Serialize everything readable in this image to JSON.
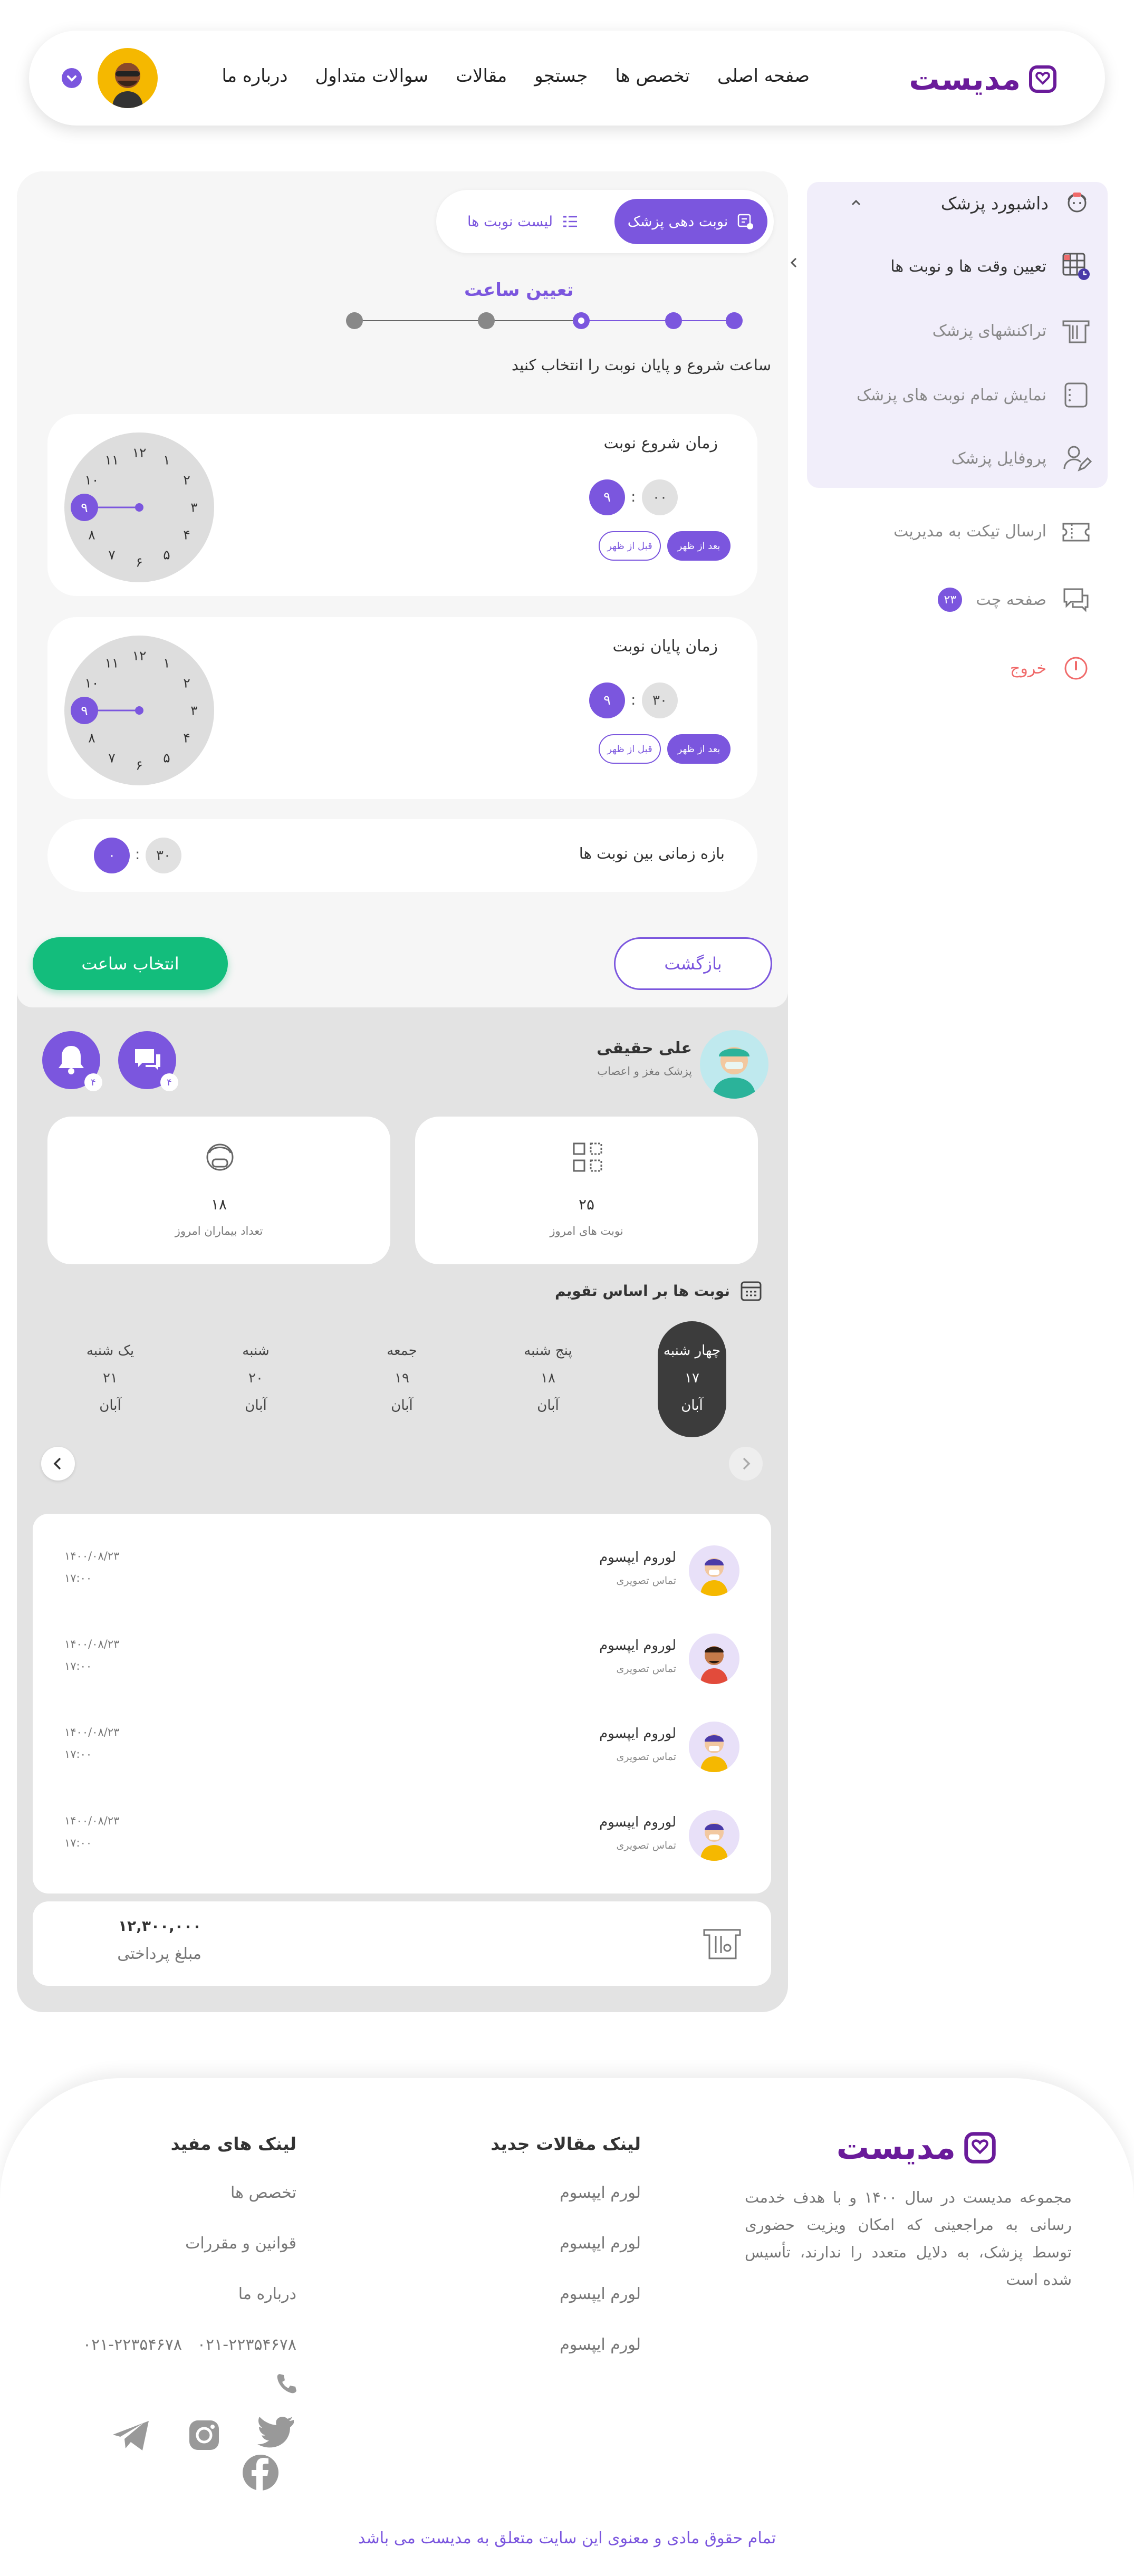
{
  "brand": {
    "name": "مدیست",
    "color": "#6a1b9a"
  },
  "header": {
    "nav": [
      "صفحه اصلی",
      "تخصص ها",
      "جستجو",
      "مقالات",
      "سوالات متداول",
      "درباره ما"
    ]
  },
  "sidebar": {
    "dashboard_title": "داشبورد پزشک",
    "items": [
      {
        "label": "تعیین وقت ها و نوبت ها",
        "icon": "calendar-grid-icon",
        "active": true
      },
      {
        "label": "تراکنشهای پزشک",
        "icon": "receipt-icon"
      },
      {
        "label": "نمایش تمام نوبت های پزشک",
        "icon": "list-box-icon"
      },
      {
        "label": "پروفایل پزشک",
        "icon": "user-edit-icon"
      }
    ],
    "ticket": "ارسال تیکت به مدیریت",
    "chat": "صفحه چت",
    "chat_badge": "۲۳",
    "logout": "خروج"
  },
  "tabs": {
    "active": "نوبت دهی پزشک",
    "inactive": "لیست نوبت ها"
  },
  "stepper": {
    "title": "تعیین ساعت",
    "instruction": "ساعت شروع و پایان نوبت را انتخاب کنید",
    "steps": 5,
    "current": 3
  },
  "start_time": {
    "title": "زمان شروع نوبت",
    "hour": "۹",
    "minute": "۰۰",
    "sep": ":",
    "am": "قبل از ظهر",
    "pm": "بعد از ظهر"
  },
  "end_time": {
    "title": "زمان پایان نوبت",
    "hour": "۹",
    "minute": "۳۰",
    "sep": ":",
    "am": "قبل از ظهر",
    "pm": "بعد از ظهر"
  },
  "clock_numbers": [
    "۱۲",
    "۱",
    "۲",
    "۳",
    "۴",
    "۵",
    "۶",
    "۷",
    "۸",
    "۹",
    "۱۰",
    "۱۱"
  ],
  "interval": {
    "label": "بازه زمانی بین نوبت ها",
    "hour": "۰",
    "minute": "۳۰",
    "sep": ":"
  },
  "buttons": {
    "select": "انتخاب ساعت",
    "back": "بازگشت"
  },
  "doctor": {
    "name": "علی حقیقی",
    "specialty": "پزشک مغز و اعصاب",
    "chat_badge": "۴",
    "bell_badge": "۴"
  },
  "stats": {
    "appointments": {
      "value": "۲۵",
      "label": "نوبت های امروز"
    },
    "patients": {
      "value": "۱۸",
      "label": "تعداد بیماران امروز"
    }
  },
  "calendar": {
    "title": "نوبت ها بر اساس تقویم",
    "days": [
      {
        "name": "چهار شنبه",
        "num": "۱۷",
        "month": "آبان",
        "active": true
      },
      {
        "name": "پنج شنبه",
        "num": "۱۸",
        "month": "آبان"
      },
      {
        "name": "جمعه",
        "num": "۱۹",
        "month": "آبان"
      },
      {
        "name": "شنبه",
        "num": "۲۰",
        "month": "آبان"
      },
      {
        "name": "یک شنبه",
        "num": "۲۱",
        "month": "آبان"
      }
    ]
  },
  "appointments": [
    {
      "name": "لوروم ایپسوم",
      "type": "تماس تصویری",
      "date": "۱۴۰۰/۰۸/۲۳",
      "time": "۱۷:۰۰"
    },
    {
      "name": "لوروم ایپسوم",
      "type": "تماس تصویری",
      "date": "۱۴۰۰/۰۸/۲۳",
      "time": "۱۷:۰۰"
    },
    {
      "name": "لوروم ایپسوم",
      "type": "تماس تصویری",
      "date": "۱۴۰۰/۰۸/۲۳",
      "time": "۱۷:۰۰"
    },
    {
      "name": "لوروم ایپسوم",
      "type": "تماس تصویری",
      "date": "۱۴۰۰/۰۸/۲۳",
      "time": "۱۷:۰۰"
    }
  ],
  "payment": {
    "amount": "۱۲,۳۰۰,۰۰۰",
    "label": "مبلغ پرداختی"
  },
  "footer": {
    "about": "مجموعه مدیست در سال ۱۴۰۰ و با هدف خدمت رسانی به مراجعینی که امکان ویزیت حضوری توسط پزشک، به دلایل متعدد را ندارند، تأسیس شده است",
    "articles_title": "لینک مقالات جدید",
    "articles": [
      "لورم ایپسوم",
      "لورم ایپسوم",
      "لورم ایپسوم",
      "لورم ایپسوم"
    ],
    "links_title": "لینک های مفید",
    "links": [
      "تخصص ها",
      "قوانین و مقررات",
      "درباره ما"
    ],
    "phones": [
      "۰۲۱-۲۲۳۵۴۶۷۸",
      "۰۲۱-۲۲۳۵۴۶۷۸"
    ],
    "copyright": "تمام حقوق مادی و معنوی این سایت متعلق به مدیست می باشد"
  },
  "colors": {
    "primary": "#7b56de",
    "green": "#13bd7c",
    "logout": "#f06a6a",
    "dark_day": "#3c3c3c"
  }
}
